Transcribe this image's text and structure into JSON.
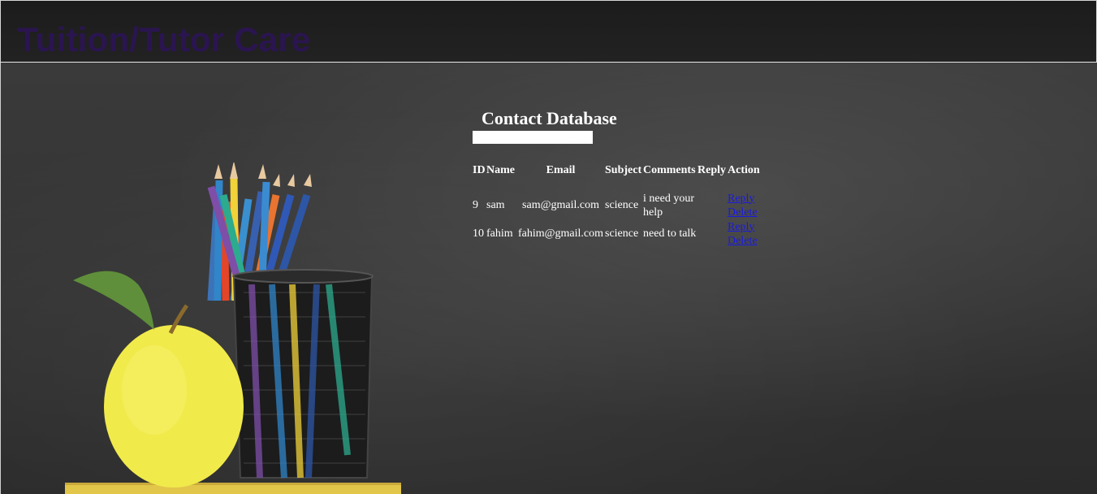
{
  "header": {
    "brand": "Tuition/Tutor Care"
  },
  "main": {
    "title": "Contact Database",
    "table": {
      "columns": [
        "ID",
        "Name",
        "Email",
        "Subject",
        "Comments",
        "Reply",
        "Action"
      ],
      "rows": [
        {
          "id": "9",
          "name": "sam",
          "email": "sam@gmail.com",
          "subject": "science",
          "comments": "i need your help",
          "reply": "",
          "actions": [
            "Reply",
            "Delete"
          ]
        },
        {
          "id": "10",
          "name": "fahim",
          "email": "fahim@gmail.com",
          "subject": "science",
          "comments": "need to talk",
          "reply": "",
          "actions": [
            "Reply",
            "Delete"
          ]
        }
      ]
    }
  },
  "colors": {
    "brand_text": "#2a1550",
    "link": "#1a1ae0",
    "board_background": "#333333"
  },
  "icons": {
    "illustration": "apple-pencils-illustration"
  }
}
